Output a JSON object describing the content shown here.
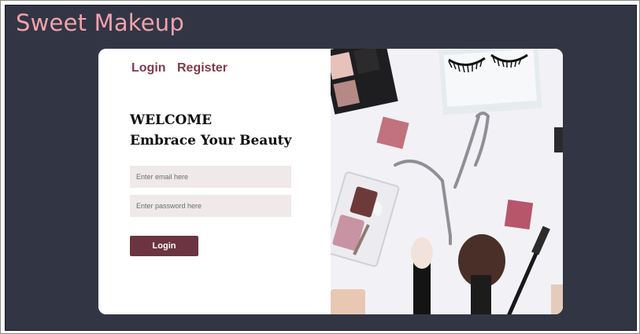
{
  "brand": {
    "title": "Sweet Makeup"
  },
  "nav": {
    "login": "Login",
    "register": "Register"
  },
  "welcome": {
    "line1": "WELCOME",
    "line2": "Embrace Your Beauty"
  },
  "form": {
    "email_placeholder": "Enter email here",
    "password_placeholder": "Enter password here",
    "submit": "Login"
  },
  "colors": {
    "page_background": "#323644",
    "brand": "#f2a1ac",
    "nav_link": "#7e3b4d",
    "button": "#6b3440",
    "field_background": "#efe9e9"
  },
  "hero_image": {
    "icons": [
      "eyeshadow-palette-icon",
      "false-lashes-icon",
      "eyelash-curler-icon",
      "makeup-brush-icon",
      "mascara-wand-icon",
      "pressed-powder-icon"
    ]
  }
}
